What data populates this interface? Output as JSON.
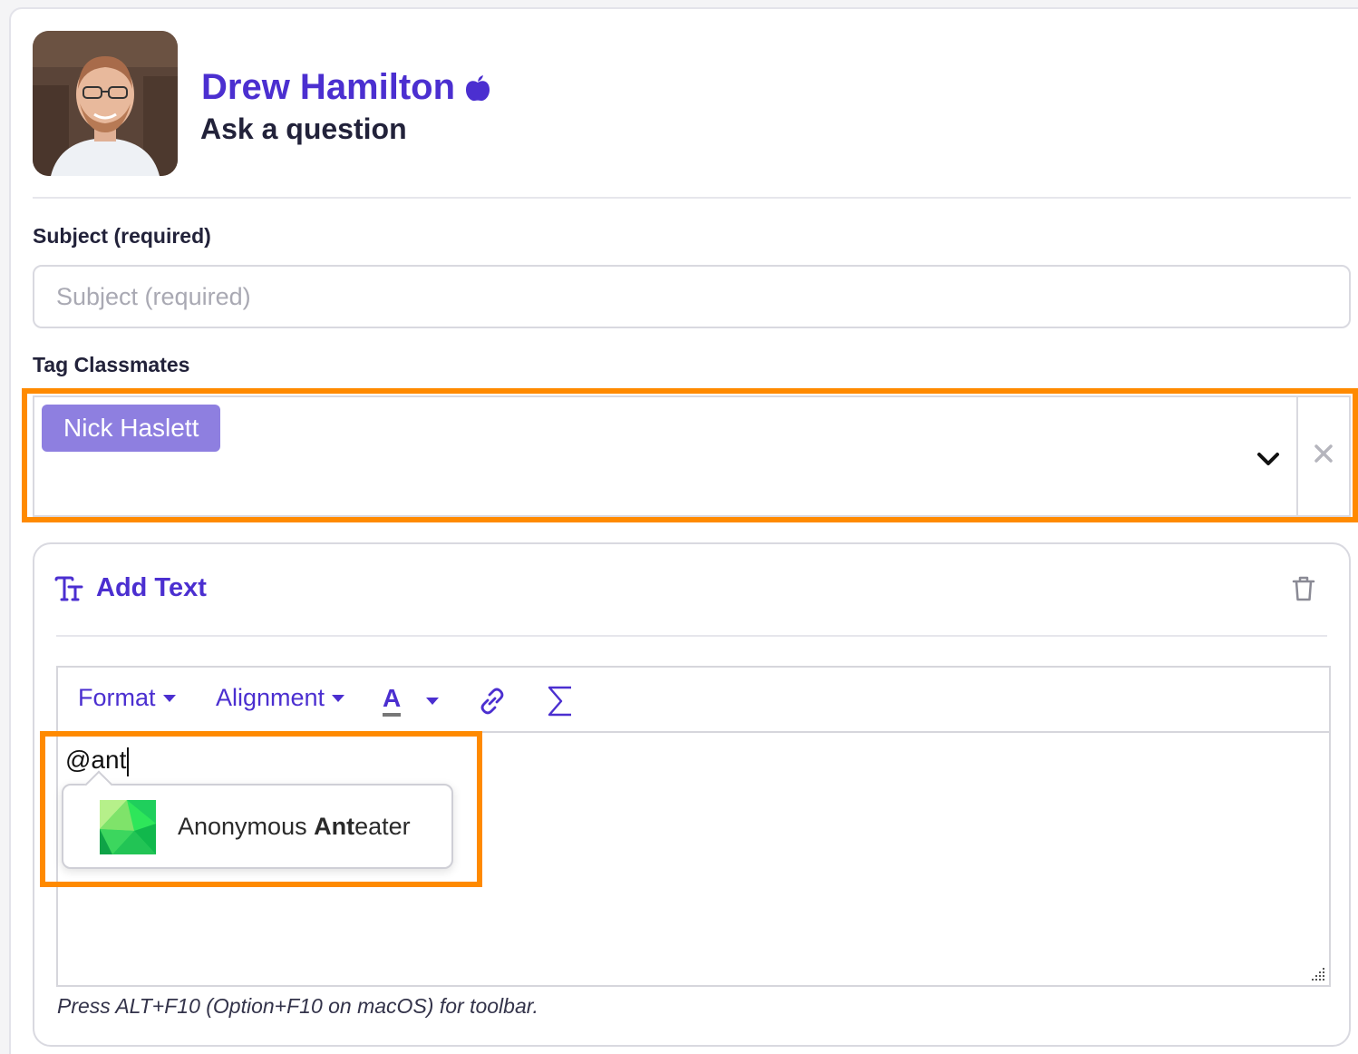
{
  "profile": {
    "name": "Drew Hamilton",
    "subtitle": "Ask a question",
    "name_color": "#4b2fd0",
    "badge_icon": "apple-icon"
  },
  "subject": {
    "label": "Subject (required)",
    "placeholder": "Subject (required)",
    "value": ""
  },
  "tags": {
    "label": "Tag Classmates",
    "selected": [
      "Nick Haslett"
    ],
    "chip_color": "#8e7fe0"
  },
  "text_block": {
    "title": "Add Text",
    "title_icon": "text-type-icon",
    "delete_icon": "trash-icon"
  },
  "toolbar": {
    "format_label": "Format",
    "alignment_label": "Alignment",
    "font_color_label": "A",
    "link_icon": "link-icon",
    "equation_icon": "sigma-icon"
  },
  "editor": {
    "content": "@ant",
    "hint": "Press ALT+F10 (Option+F10 on macOS) for toolbar."
  },
  "mention": {
    "suggestion_prefix": "Anonymous ",
    "suggestion_match": "Ant",
    "suggestion_suffix": "eater"
  },
  "colors": {
    "highlight": "#ff8a00",
    "accent": "#4b2fd0"
  }
}
